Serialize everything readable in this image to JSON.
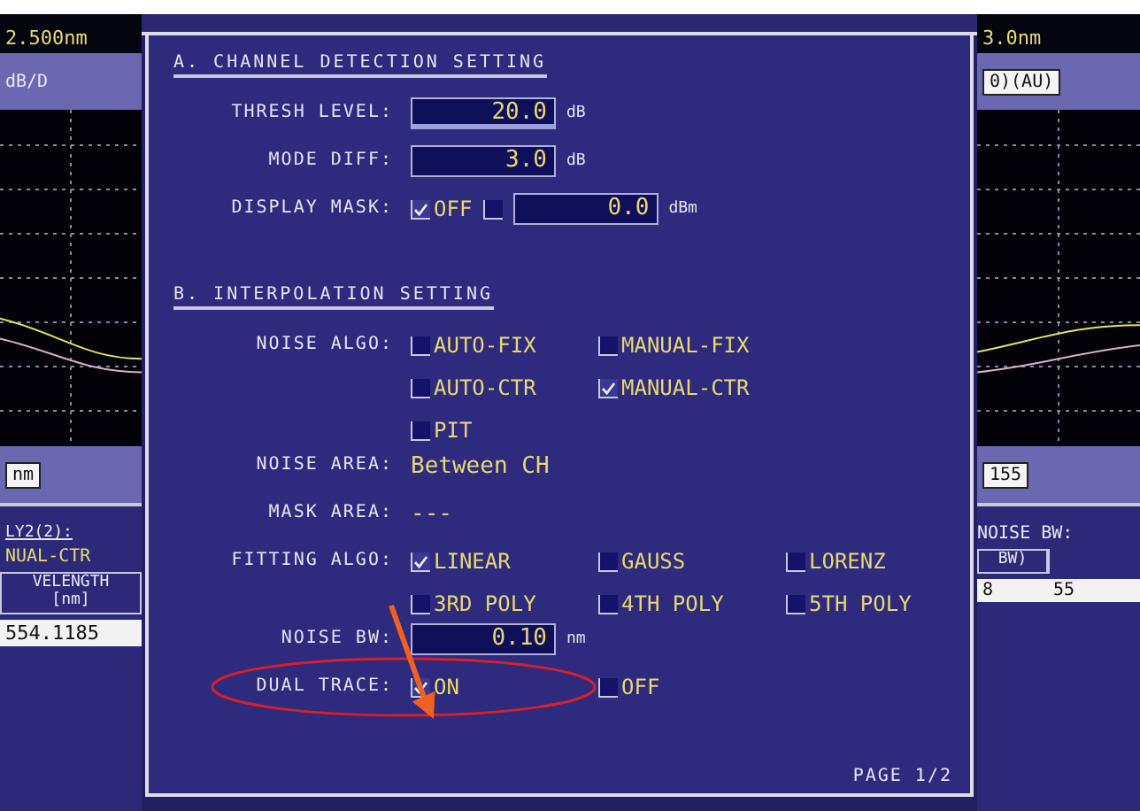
{
  "left_panel": {
    "span": "2.500nm",
    "scale": "dB/D",
    "unit": "nm",
    "algo_label": "LY2(2):",
    "algo_value": "NUAL-CTR",
    "column_header": "VELENGTH",
    "column_unit": "[nm]",
    "cell": "554.1185"
  },
  "right_panel": {
    "span": "3.0nm",
    "field": "0)(AU)",
    "marker": "155",
    "noise_label": "NOISE BW:",
    "column_headers": [
      "BW)"
    ],
    "cells": [
      "8",
      "55"
    ]
  },
  "dialog": {
    "sections": [
      {
        "title": "A. CHANNEL DETECTION SETTING",
        "rows": [
          {
            "label": "THRESH LEVEL:",
            "lines": [
              [
                {
                  "kind": "field",
                  "value": "20.0",
                  "unit": "dB",
                  "focused": true
                }
              ]
            ]
          },
          {
            "label": "MODE DIFF:",
            "lines": [
              [
                {
                  "kind": "field",
                  "value": "3.0",
                  "unit": "dB",
                  "focused": false
                }
              ]
            ]
          },
          {
            "label": "DISPLAY MASK:",
            "lines": [
              [
                {
                  "kind": "check",
                  "label": "OFF",
                  "checked": true
                },
                {
                  "kind": "field",
                  "value": "0.0",
                  "unit": "dBm",
                  "focused": false,
                  "checked": false
                }
              ]
            ]
          }
        ]
      },
      {
        "title": "B. INTERPOLATION SETTING",
        "rows": [
          {
            "label": "NOISE ALGO:",
            "lines": [
              [
                {
                  "kind": "check",
                  "label": "AUTO-FIX",
                  "checked": false
                },
                {
                  "kind": "check",
                  "label": "MANUAL-FIX",
                  "checked": false
                }
              ],
              [
                {
                  "kind": "check",
                  "label": "AUTO-CTR",
                  "checked": false
                },
                {
                  "kind": "check",
                  "label": "MANUAL-CTR",
                  "checked": true
                }
              ],
              [
                {
                  "kind": "check",
                  "label": "PIT",
                  "checked": false
                }
              ]
            ]
          },
          {
            "label": "NOISE AREA:",
            "lines": [
              [
                {
                  "kind": "text",
                  "value": "Between CH"
                }
              ]
            ]
          },
          {
            "label": "MASK AREA:",
            "lines": [
              [
                {
                  "kind": "text",
                  "value": "---"
                }
              ]
            ]
          },
          {
            "label": "FITTING ALGO:",
            "lines": [
              [
                {
                  "kind": "check",
                  "label": "LINEAR",
                  "checked": true
                },
                {
                  "kind": "check",
                  "label": "GAUSS",
                  "checked": false
                },
                {
                  "kind": "check",
                  "label": "LORENZ",
                  "checked": false
                }
              ],
              [
                {
                  "kind": "check",
                  "label": "3RD POLY",
                  "checked": false
                },
                {
                  "kind": "check",
                  "label": "4TH POLY",
                  "checked": false
                },
                {
                  "kind": "check",
                  "label": "5TH POLY",
                  "checked": false
                }
              ]
            ]
          },
          {
            "label": "NOISE BW:",
            "lines": [
              [
                {
                  "kind": "field",
                  "value": "0.10",
                  "unit": "nm",
                  "focused": false
                }
              ]
            ]
          },
          {
            "label": "DUAL TRACE:",
            "highlighted": true,
            "lines": [
              [
                {
                  "kind": "check",
                  "label": "ON",
                  "checked": true
                },
                {
                  "kind": "check",
                  "label": "OFF",
                  "checked": false
                }
              ]
            ]
          }
        ]
      }
    ],
    "page": "PAGE 1/2"
  }
}
